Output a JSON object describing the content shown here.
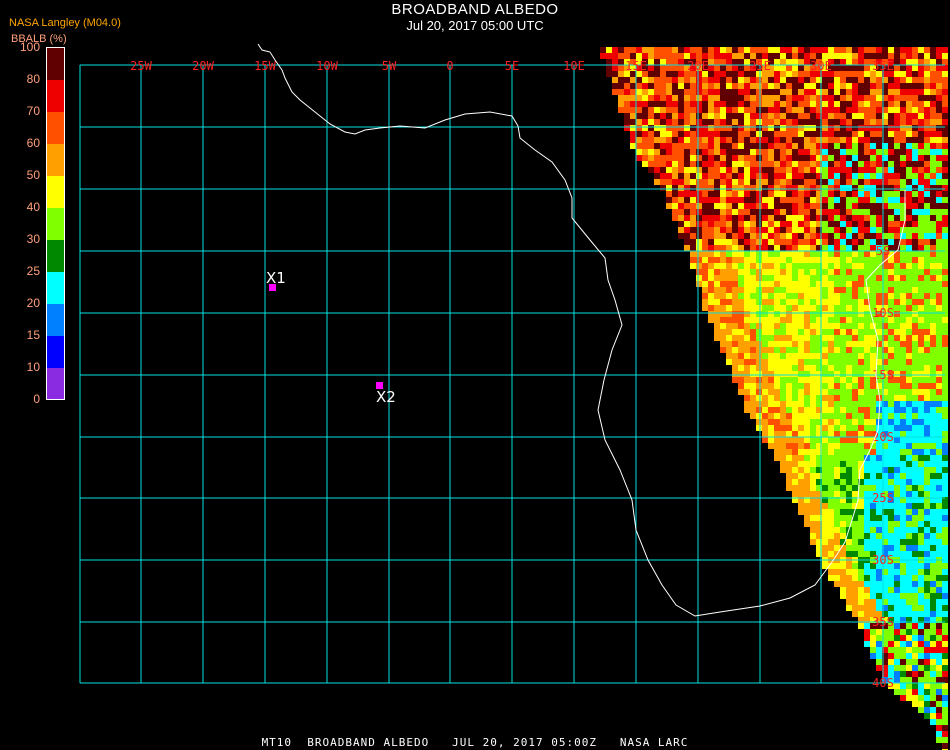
{
  "header": {
    "title": "BROADBAND ALBEDO",
    "datetime": "Jul 20, 2017 05:00 UTC",
    "source": "NASA Langley (M04.0)"
  },
  "legend": {
    "label": "BBALB (%)",
    "ticks": [
      "100",
      "80",
      "70",
      "60",
      "50",
      "40",
      "30",
      "25",
      "20",
      "15",
      "10",
      "0"
    ],
    "colors": [
      "#600000",
      "#ee0000",
      "#ff5000",
      "#ffa000",
      "#ffff00",
      "#80ff00",
      "#008800",
      "#00ffff",
      "#0080ff",
      "#0000ff",
      "#8a2be2"
    ]
  },
  "map": {
    "longitude_labels": [
      "25W",
      "20W",
      "15W",
      "10W",
      "5W",
      "0",
      "5E",
      "10E",
      "15E",
      "20E",
      "25E",
      "30E",
      "35E"
    ],
    "latitude_labels": [
      "5S",
      "10S",
      "15S",
      "20S",
      "25S",
      "30S",
      "35S",
      "40S"
    ],
    "grid_color": "#00e0e0",
    "label_color": "#ff2020",
    "markers": [
      {
        "label": "X1",
        "color": "#ff00ff"
      },
      {
        "label": "X2",
        "color": "#ff00ff"
      }
    ]
  },
  "footer": "MT10  BROADBAND ALBEDO   JUL 20, 2017 05:00Z   NASA LARC"
}
